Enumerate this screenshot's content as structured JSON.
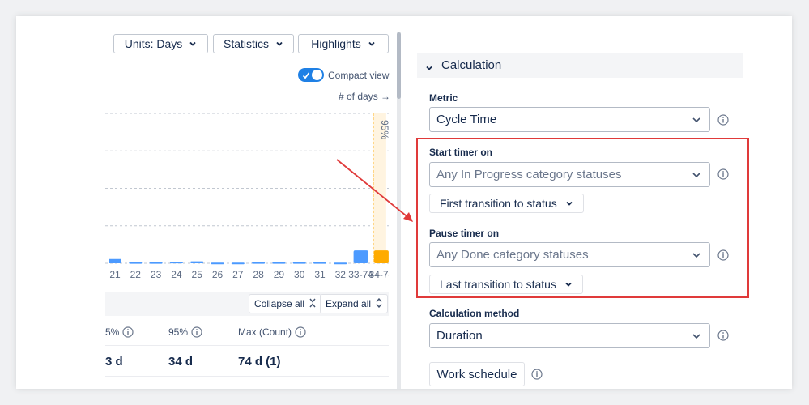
{
  "toolbar": {
    "units_label": "Units: Days",
    "statistics_label": "Statistics",
    "highlights_label": "Highlights"
  },
  "compact_view": {
    "label": "Compact view",
    "enabled": true
  },
  "days_link": "# of days →",
  "chart_data": {
    "type": "bar",
    "categories": [
      "21",
      "22",
      "23",
      "24",
      "25",
      "26",
      "27",
      "28",
      "29",
      "30",
      "31",
      "32",
      "33-74",
      "34-74"
    ],
    "values": [
      2,
      0.5,
      0.5,
      0.7,
      0.9,
      0.3,
      0.3,
      0.5,
      0.5,
      0.5,
      0.5,
      0.3,
      6,
      6
    ],
    "bar_colors": [
      "#4c9aff",
      "#4c9aff",
      "#4c9aff",
      "#4c9aff",
      "#4c9aff",
      "#4c9aff",
      "#4c9aff",
      "#4c9aff",
      "#4c9aff",
      "#4c9aff",
      "#4c9aff",
      "#4c9aff",
      "#4c9aff",
      "#ffab00"
    ],
    "percentile_marker": {
      "label": "95%",
      "category": "34-74"
    },
    "grid": true,
    "ylim": [
      0,
      70
    ]
  },
  "table": {
    "collapse_all": "Collapse all",
    "expand_all": "Expand all",
    "headers": [
      "5%",
      "95%",
      "Max (Count)"
    ],
    "row": [
      "3 d",
      "34 d",
      "74 d (1)"
    ]
  },
  "calculation": {
    "title": "Calculation",
    "metric_label": "Metric",
    "metric_value": "Cycle Time",
    "start_label": "Start timer on",
    "start_placeholder": "Any In Progress category statuses",
    "start_transition": "First transition to status",
    "pause_label": "Pause timer on",
    "pause_placeholder": "Any Done category statuses",
    "pause_transition": "Last transition to status",
    "method_label": "Calculation method",
    "method_value": "Duration",
    "work_schedule": "Work schedule"
  },
  "colors": {
    "accent": "#1f80e5",
    "bar_blue": "#4c9aff",
    "bar_orange": "#ffab00",
    "highlight_red": "#e03a3a"
  }
}
